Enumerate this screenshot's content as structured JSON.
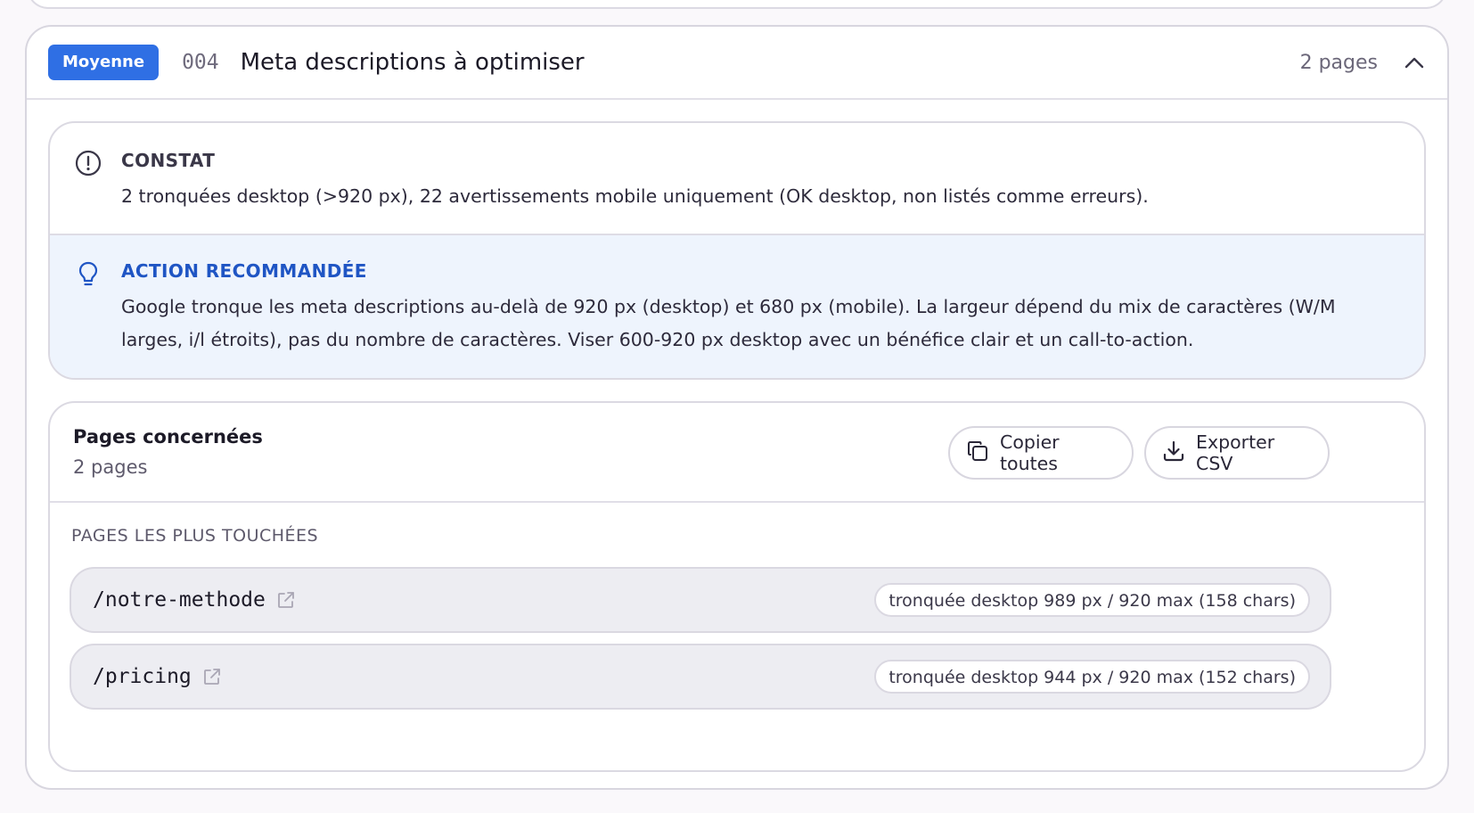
{
  "issue": {
    "severity": "Moyenne",
    "code": "004",
    "title": "Meta descriptions à optimiser",
    "count_label": "2 pages"
  },
  "constat": {
    "heading": "CONSTAT",
    "text": "2 tronquées desktop (>920 px), 22 avertissements mobile uniquement (OK desktop, non listés comme erreurs)."
  },
  "action": {
    "heading": "ACTION RECOMMANDÉE",
    "text": "Google tronque les meta descriptions au-delà de 920 px (desktop) et 680 px (mobile). La largeur dépend du mix de caractères (W/M larges, i/l étroits), pas du nombre de caractères. Viser 600-920 px desktop avec un bénéfice clair et un call-to-action."
  },
  "pages": {
    "heading": "Pages concernées",
    "subheading": "2 pages",
    "copy_label": "Copier toutes",
    "export_label": "Exporter CSV",
    "most_affected_heading": "PAGES LES PLUS TOUCHÉES",
    "rows": [
      {
        "path": "/notre-methode",
        "detail": "tronquée desktop 989 px / 920 max (158 chars)"
      },
      {
        "path": "/pricing",
        "detail": "tronquée desktop 944 px / 920 max (152 chars)"
      }
    ]
  },
  "colors": {
    "badge": "#2f6fe4",
    "action_background": "#eef4fd",
    "action_heading": "#1f55c4"
  },
  "icons": {
    "collapse": "chevron-up-icon",
    "constat": "alert-circle-icon",
    "action": "lightbulb-icon",
    "copy": "copy-icon",
    "export": "download-icon",
    "external": "external-link-icon"
  }
}
